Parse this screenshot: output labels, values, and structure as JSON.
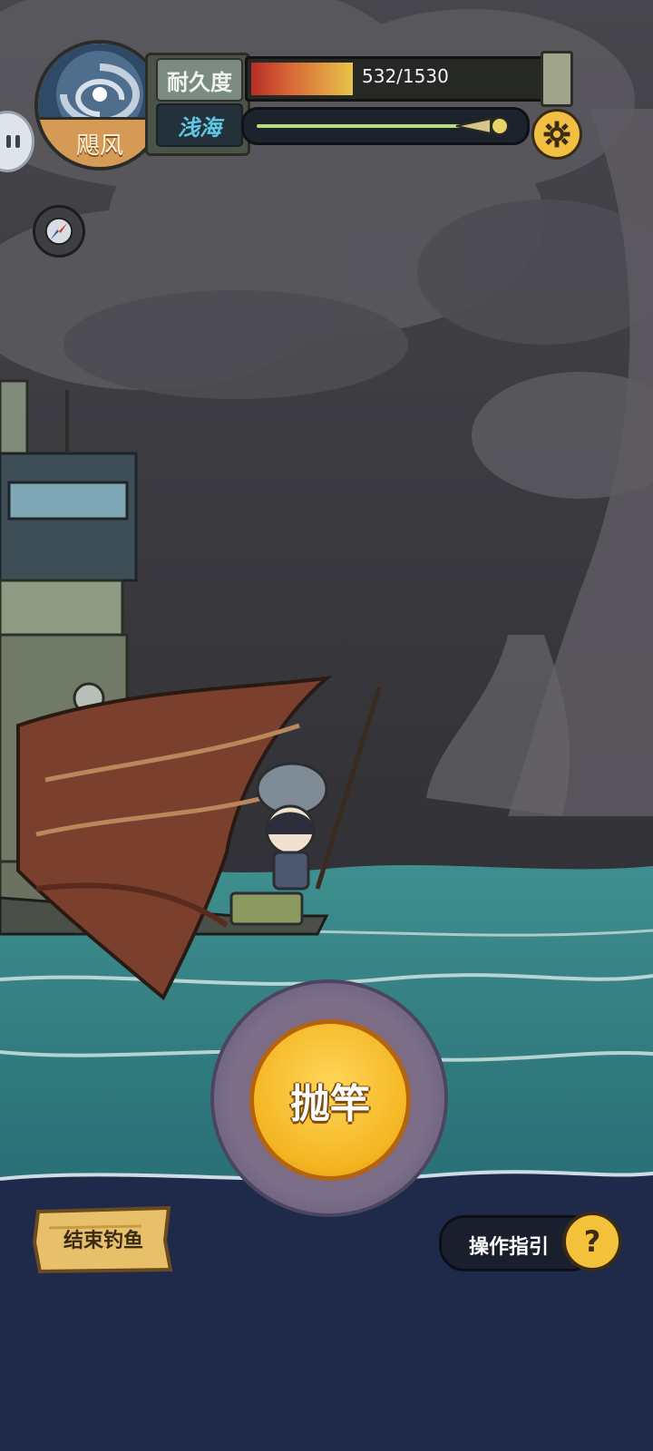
{
  "hud": {
    "weather": {
      "label": "飓风",
      "icon": "hurricane-icon"
    },
    "durability": {
      "label": "耐久度",
      "current": 532,
      "max": 1530,
      "text": "532/1530",
      "fill_fraction": 0.348
    },
    "depth": {
      "label": "浅海",
      "progress": 0.98
    },
    "settings_icon": "gear-icon"
  },
  "sidebar": {
    "chat_icon": "chat-bubble-icon",
    "compass_icon": "compass-icon"
  },
  "actions": {
    "cast_label": "抛竿",
    "end_label": "结束钓鱼",
    "guide_label": "操作指引",
    "guide_icon": "question-mark-icon",
    "guide_icon_text": "?"
  },
  "colors": {
    "sky": "#3a3a40",
    "sea": "#2e7f82",
    "deep_sea": "#1f2a4a",
    "button_gold": "#f4b521"
  }
}
